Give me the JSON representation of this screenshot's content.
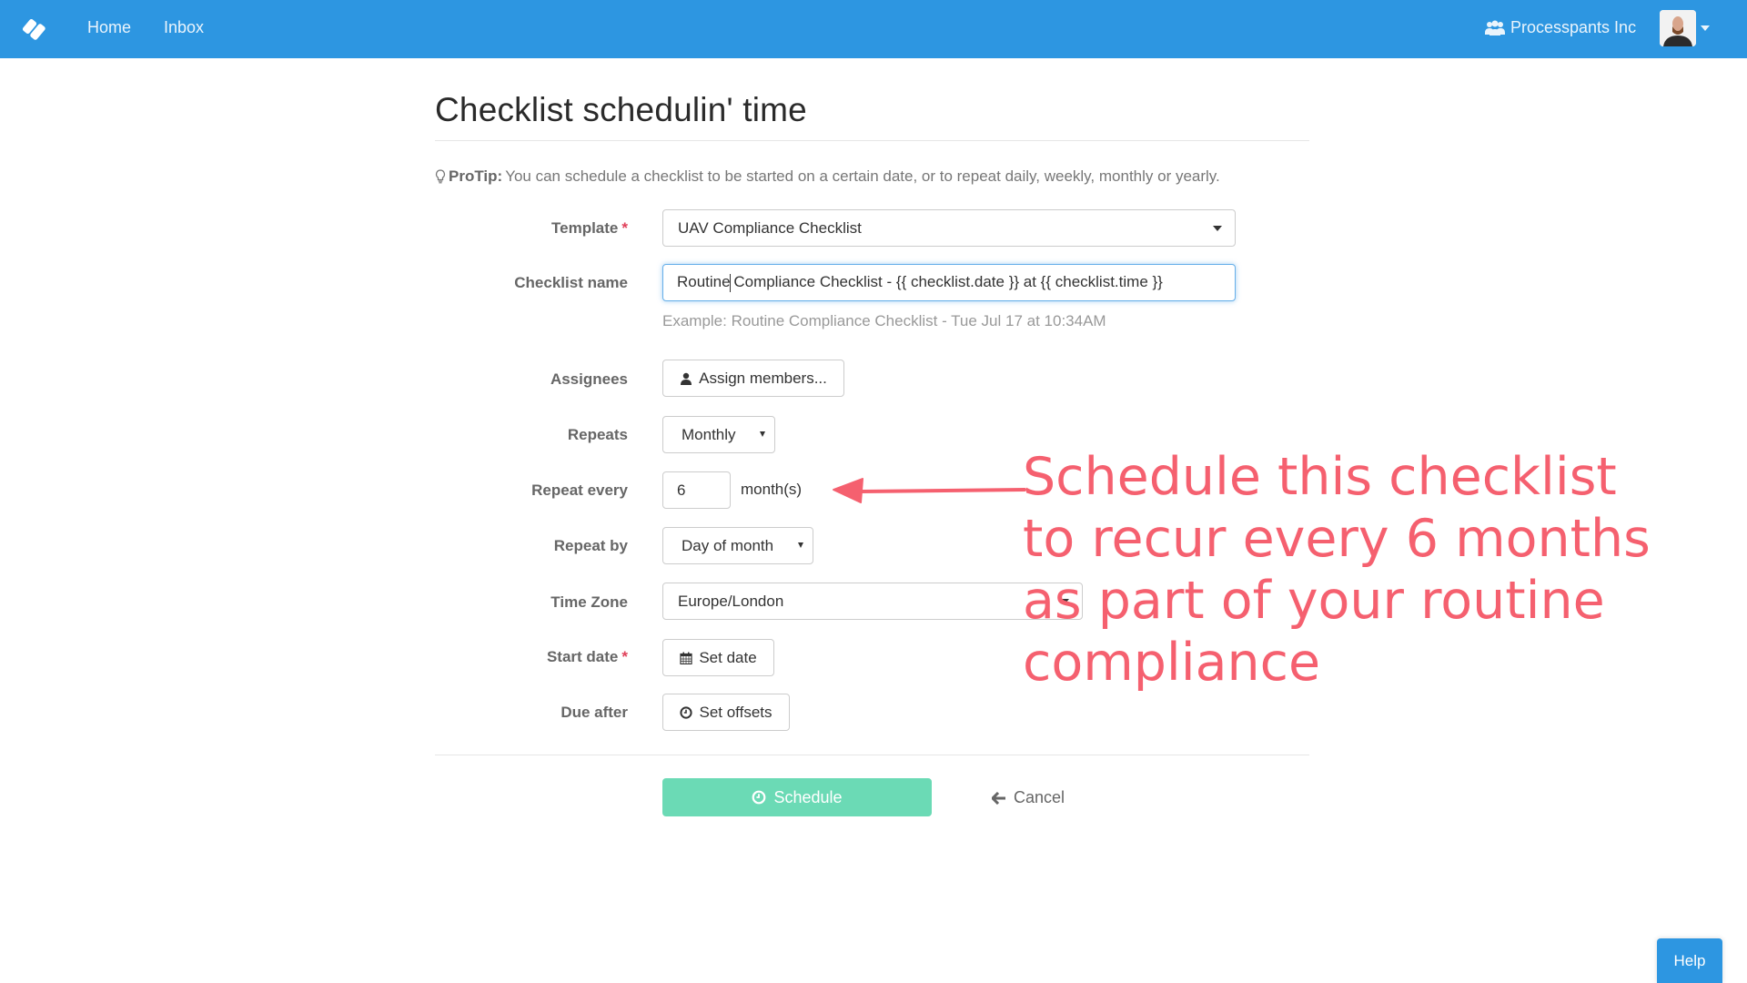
{
  "navbar": {
    "brand_icon": "process-street-logo-icon",
    "links": [
      {
        "label": "Home"
      },
      {
        "label": "Inbox"
      }
    ],
    "organization": {
      "icon": "users-icon",
      "label": "Processpants Inc"
    },
    "user_menu": {
      "avatar": "user-avatar",
      "icon": "caret-down-icon"
    }
  },
  "page": {
    "title": "Checklist schedulin' time",
    "protip": {
      "icon": "lightbulb-icon",
      "label": "ProTip:",
      "text": "You can schedule a checklist to be started on a certain date, or to repeat daily, weekly, monthly or yearly."
    }
  },
  "form": {
    "required_marker": "*",
    "template": {
      "label": "Template",
      "value": "UAV Compliance Checklist"
    },
    "checklist_name": {
      "label": "Checklist name",
      "value_before_cursor": "Routine",
      "value_after_cursor": " Compliance Checklist - {{ checklist.date }} at {{ checklist.time }}",
      "help": "Example: Routine Compliance Checklist - Tue Jul 17 at 10:34AM"
    },
    "assignees": {
      "label": "Assignees",
      "button": "Assign members...",
      "icon": "user-icon"
    },
    "repeats": {
      "label": "Repeats",
      "value": "Monthly"
    },
    "repeat_every": {
      "label": "Repeat every",
      "value": "6",
      "unit": "month(s)"
    },
    "repeat_by": {
      "label": "Repeat by",
      "value": "Day of month"
    },
    "time_zone": {
      "label": "Time Zone",
      "value": "Europe/London"
    },
    "start_date": {
      "label": "Start date",
      "button": "Set date",
      "icon": "calendar-icon"
    },
    "due_after": {
      "label": "Due after",
      "button": "Set offsets",
      "icon": "clock-icon"
    }
  },
  "actions": {
    "schedule": {
      "label": "Schedule",
      "icon": "clock-icon"
    },
    "cancel": {
      "label": "Cancel",
      "icon": "arrow-left-icon"
    }
  },
  "annotation": {
    "lines": [
      "Schedule this checklist",
      "to recur every 6 months",
      "as part of your routine",
      "compliance"
    ],
    "color": "#f5606f"
  },
  "help_button": {
    "label": "Help"
  },
  "colors": {
    "navbar": "#2d96e1",
    "schedule_button": "#6bdab5",
    "required": "#e0405a"
  }
}
